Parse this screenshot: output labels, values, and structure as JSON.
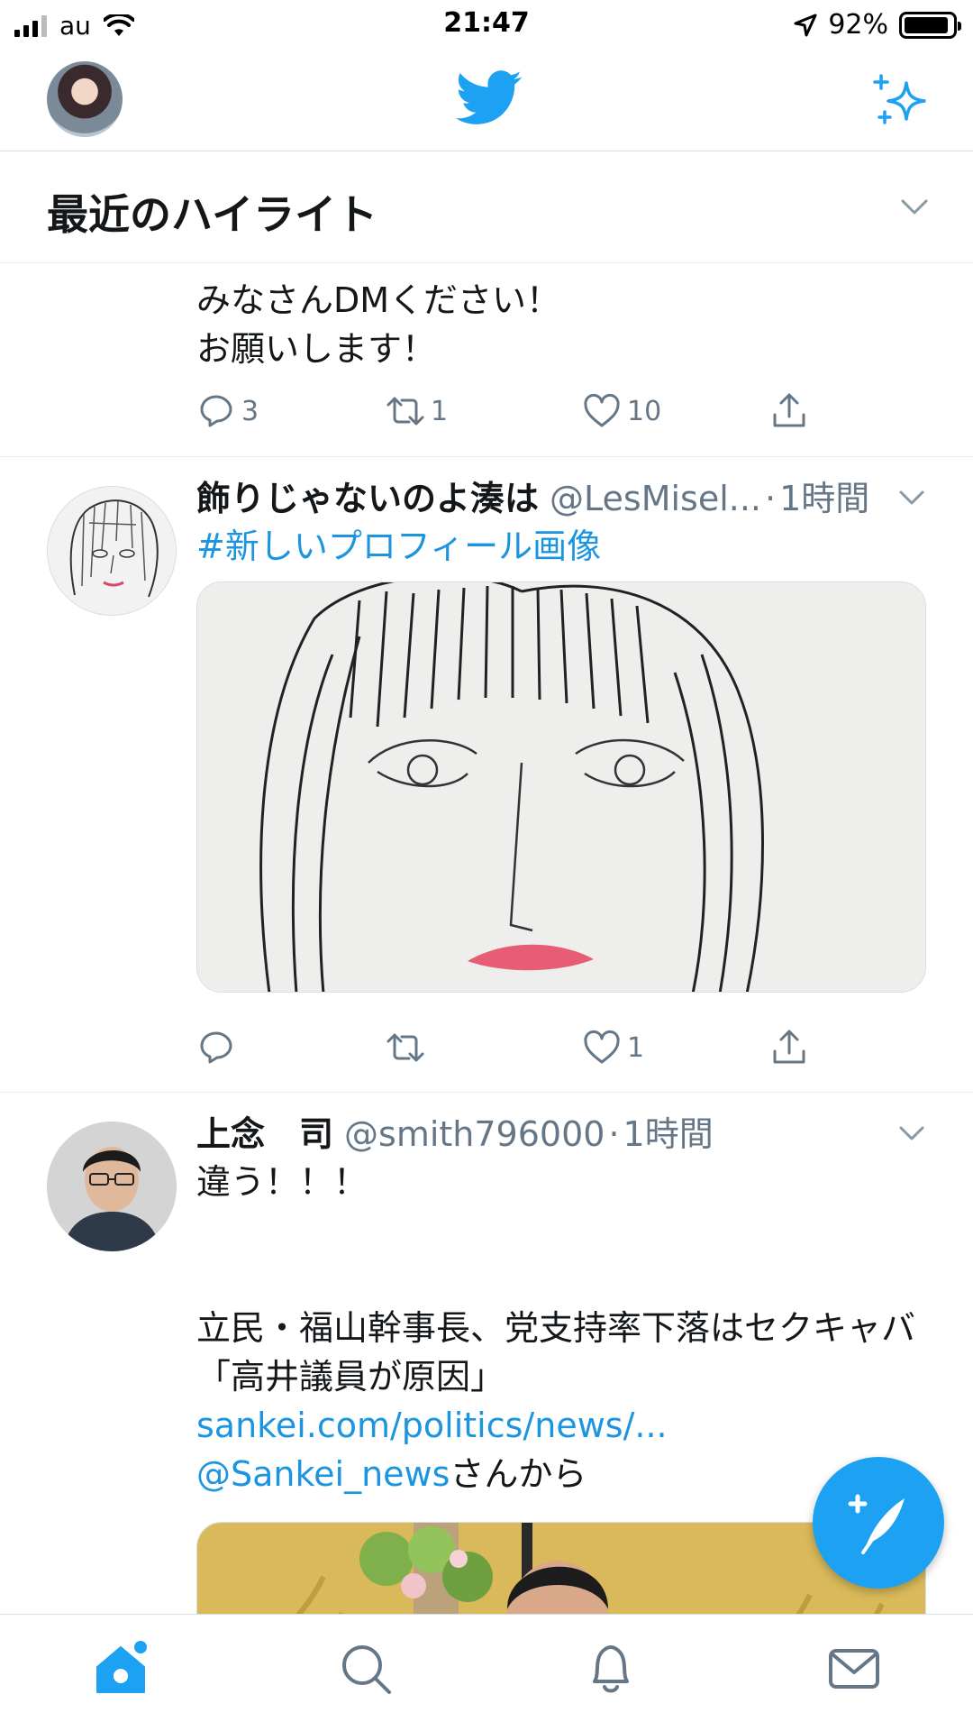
{
  "status_bar": {
    "carrier": "au",
    "time": "21:47",
    "battery": "92%",
    "battery_level": 0.92
  },
  "nav": {
    "avatar_icon": "profile-avatar",
    "logo_icon": "twitter-bird-icon",
    "sparkle_icon": "sparkle-icon"
  },
  "highlights": {
    "title": "最近のハイライト"
  },
  "tweets": [
    {
      "text_line1": "みなさんDMください！",
      "text_line2": "お願いします！",
      "replies": "3",
      "retweets": "1",
      "likes": "10"
    },
    {
      "name": "飾りじゃないのよ湊は",
      "handle": "@LesMisel...",
      "sep": "·",
      "time": "1時間",
      "hashtag": "#新しいプロフィール画像",
      "replies": "",
      "retweets": "",
      "likes": "1"
    },
    {
      "name": "上念　司",
      "handle": "@smith796000",
      "sep": "·",
      "time": "1時間",
      "text_line1": "違う！！！",
      "text_body": "立民・福山幹事長、党支持率下落はセクキャバ「高井議員が原因」",
      "link1": "sankei.com/politics/news/...",
      "mention": "@Sankei_news",
      "suffix": "さんから"
    }
  ],
  "colors": {
    "accent": "#1da1f2",
    "link": "#1b95e0",
    "secondary_text": "#657786",
    "divider": "#e6ecf0"
  }
}
